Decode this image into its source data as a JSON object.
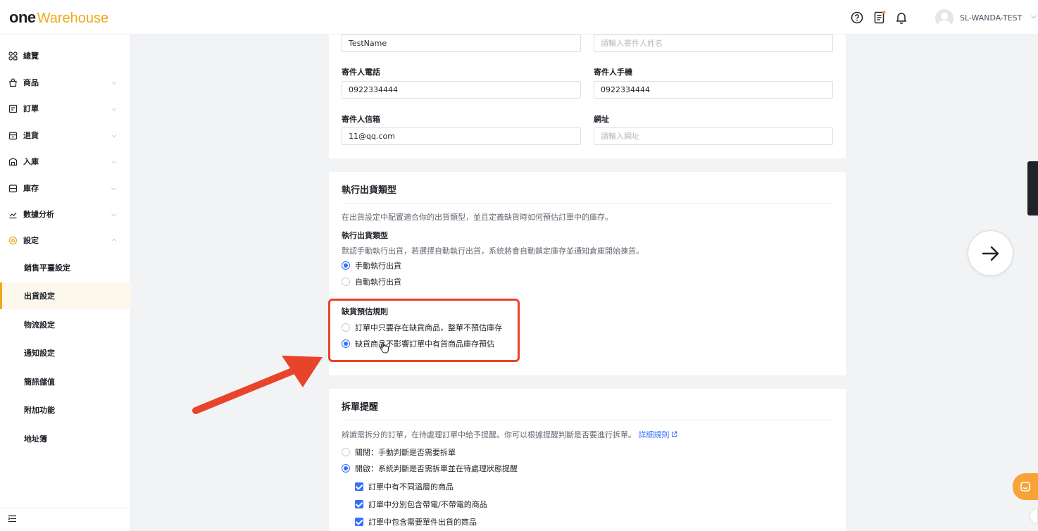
{
  "app": {
    "logo_one": "one",
    "logo_warehouse": "Warehouse",
    "user_name": "SL-WANDA-TEST"
  },
  "colors": {
    "accent": "#f0a81c",
    "primary": "#3370ff",
    "highlight": "#e8442c"
  },
  "sidebar": {
    "items": [
      {
        "label": "總覽",
        "icon": "dashboard-icon"
      },
      {
        "label": "商品",
        "icon": "product-bag-icon"
      },
      {
        "label": "訂單",
        "icon": "order-icon"
      },
      {
        "label": "退貨",
        "icon": "return-icon"
      },
      {
        "label": "入庫",
        "icon": "inbound-icon"
      },
      {
        "label": "庫存",
        "icon": "inventory-icon"
      },
      {
        "label": "數據分析",
        "icon": "analytics-icon"
      },
      {
        "label": "設定",
        "icon": "settings-icon"
      }
    ],
    "sub_items": [
      {
        "label": "銷售平臺設定"
      },
      {
        "label": "出貨設定",
        "active": true
      },
      {
        "label": "物流設定"
      },
      {
        "label": "通知設定"
      },
      {
        "label": "簡訊儲值"
      },
      {
        "label": "附加功能"
      },
      {
        "label": "地址簿"
      }
    ]
  },
  "sender_card": {
    "name_value": "TestName",
    "name_placeholder": "請輸入寄件人姓名",
    "phone_label": "寄件人電話",
    "phone_value": "0922334444",
    "mobile_label": "寄件人手機",
    "mobile_value": "0922334444",
    "email_label": "寄件人信箱",
    "email_value": "11@qq.com",
    "website_label": "網址",
    "website_placeholder": "請輸入網址"
  },
  "shipping_type_card": {
    "title": "執行出貨類型",
    "description": "在出貨設定中配置適合你的出貨類型，並且定義缺貨時如何預估訂單中的庫存。",
    "type_label": "執行出貨類型",
    "type_description": "默認手動執行出貨，若選擇自動執行出貨，系統將會自動鎖定庫存並通知倉庫開始揀貨。",
    "type_options": [
      {
        "label": "手動執行出貨",
        "selected": true
      },
      {
        "label": "自動執行出貨",
        "selected": false
      }
    ],
    "shortage_label": "缺貨預估規則",
    "shortage_options": [
      {
        "label": "訂單中只要存在缺貨商品，整單不預估庫存",
        "selected": false
      },
      {
        "label": "缺貨商品不影響訂單中有貨商品庫存預估",
        "selected": true
      }
    ]
  },
  "split_card": {
    "title": "拆單提醒",
    "description": "辨識需拆分的訂單，在待處理訂單中給予提醒。你可以根據提醒判斷是否要進行拆單。",
    "rules_link": "詳細規則",
    "options": [
      {
        "label": "關閉：手動判斷是否需要拆單",
        "selected": false
      },
      {
        "label": "開啟：系統判斷是否需拆單並在待處理狀態提醒",
        "selected": true
      }
    ],
    "checks": [
      {
        "label": "訂單中有不同溫層的商品",
        "checked": true
      },
      {
        "label": "訂單中分別包含帶電/不帶電的商品",
        "checked": true
      },
      {
        "label": "訂單中包含需要單件出貨的商品",
        "checked": true
      }
    ]
  }
}
